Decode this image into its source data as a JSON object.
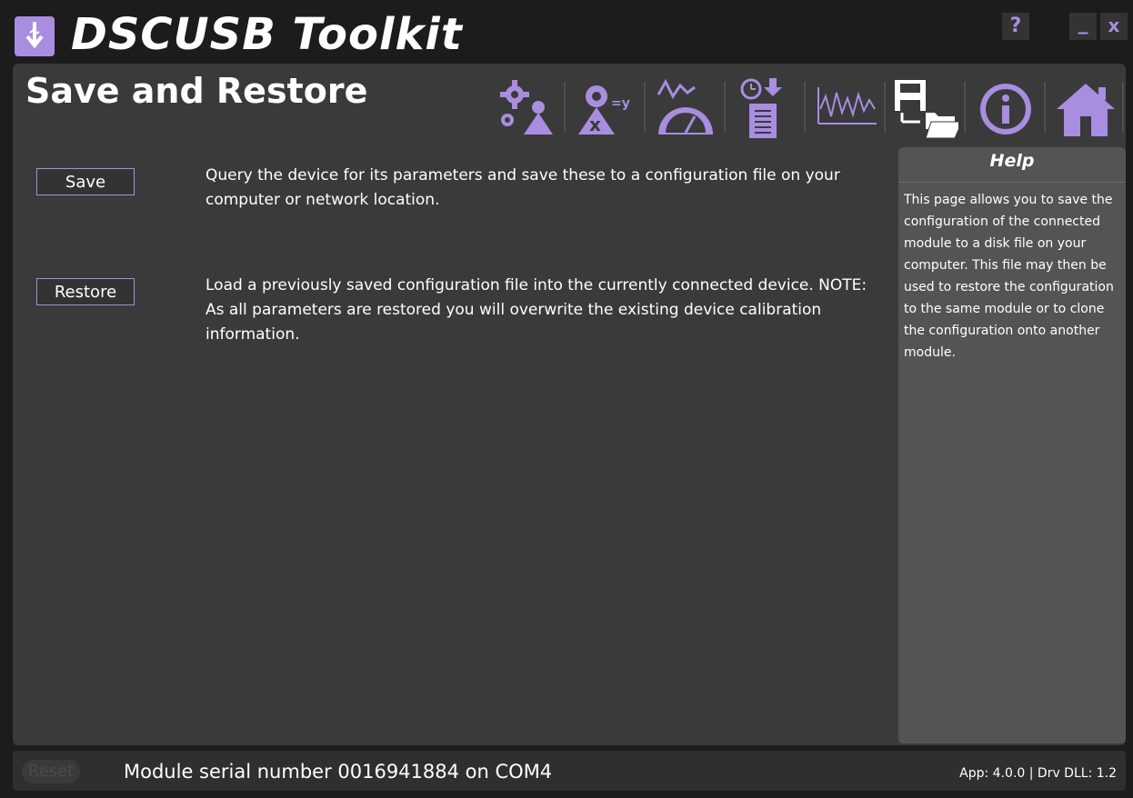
{
  "app": {
    "title": "DSCUSB Toolkit",
    "accent_color": "#a88de0",
    "window_buttons": {
      "help": "?",
      "minimize": "_",
      "close": "x"
    }
  },
  "page": {
    "title": "Save and Restore"
  },
  "toolbar": {
    "items": [
      {
        "icon": "settings-gears-icon"
      },
      {
        "icon": "calibration-x-equals-y-icon"
      },
      {
        "icon": "gauge-meter-icon"
      },
      {
        "icon": "datalog-clock-download-icon"
      },
      {
        "icon": "waveform-chart-icon"
      },
      {
        "icon": "save-restore-disk-folder-icon"
      },
      {
        "icon": "info-icon"
      },
      {
        "icon": "home-icon"
      }
    ]
  },
  "actions": {
    "save": {
      "label": "Save",
      "description": "Query the device for its parameters and save these to a configuration file on your computer or network location."
    },
    "restore": {
      "label": "Restore",
      "description": "Load a previously saved configuration file into the currently connected device. NOTE: As all parameters are restored you will overwrite the existing device calibration information."
    }
  },
  "help": {
    "title": "Help",
    "text": "This page allows you to save the configuration of the connected module to a disk file on your computer. This file may then be used to restore the configuration to the same module or to clone the configuration onto another module."
  },
  "status": {
    "reset_label": "Reset",
    "serial_text": "Module serial number 0016941884 on COM4",
    "version_text": "App: 4.0.0 | Drv DLL: 1.2"
  }
}
